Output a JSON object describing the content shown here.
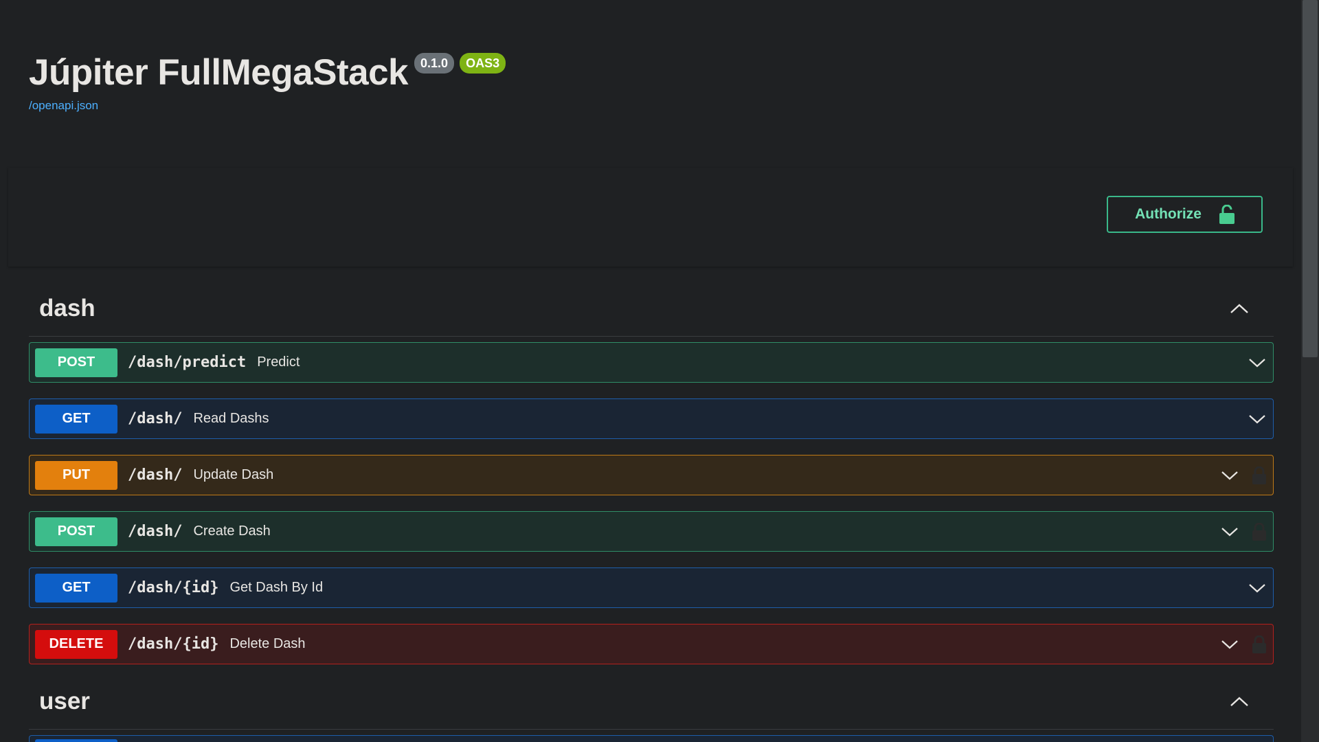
{
  "info": {
    "title": "Júpiter FullMegaStack",
    "version": "0.1.0",
    "oas": "OAS3",
    "spec_link": "/openapi.json"
  },
  "authorize": {
    "label": "Authorize",
    "icon": "unlocked-padlock-icon"
  },
  "tags": [
    {
      "name": "dash",
      "expanded": true,
      "operations": [
        {
          "method": "POST",
          "path": "/dash/predict",
          "summary": "Predict",
          "locked": false
        },
        {
          "method": "GET",
          "path": "/dash/",
          "summary": "Read Dashs",
          "locked": false
        },
        {
          "method": "PUT",
          "path": "/dash/",
          "summary": "Update Dash",
          "locked": true
        },
        {
          "method": "POST",
          "path": "/dash/",
          "summary": "Create Dash",
          "locked": true
        },
        {
          "method": "GET",
          "path": "/dash/{id}",
          "summary": "Get Dash By Id",
          "locked": false
        },
        {
          "method": "DELETE",
          "path": "/dash/{id}",
          "summary": "Delete Dash",
          "locked": true
        }
      ]
    },
    {
      "name": "user",
      "expanded": true,
      "operations": []
    }
  ],
  "colors": {
    "background": "#1f2123",
    "post": "#3dbc8b",
    "get": "#0d5fc7",
    "put": "#e3800d",
    "delete": "#d40d0d",
    "authorize": "#3ab98a",
    "link": "#4db0ff"
  }
}
